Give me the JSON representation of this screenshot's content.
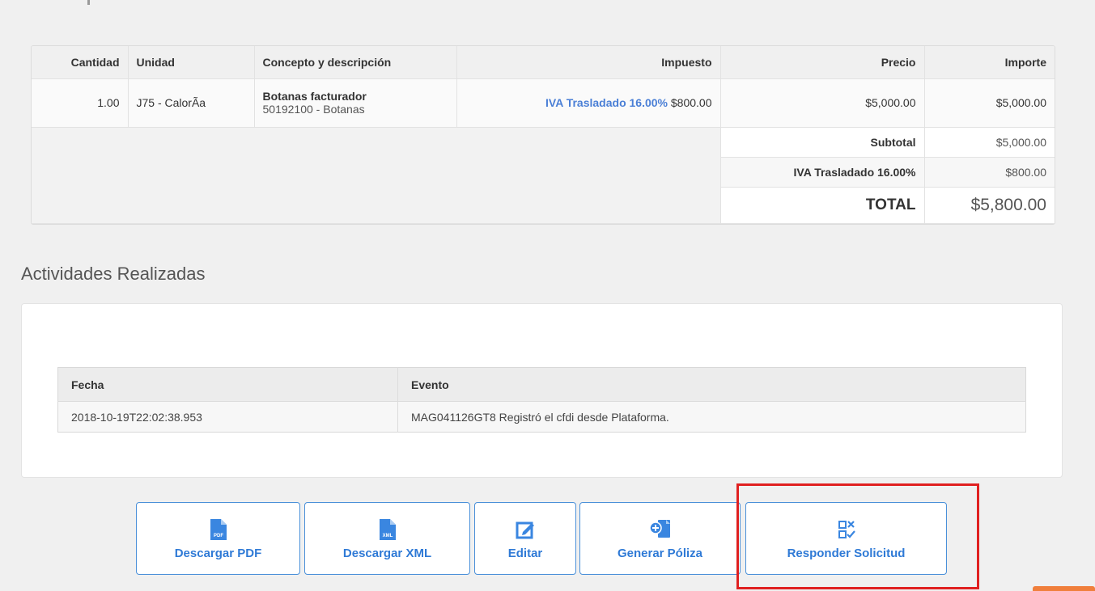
{
  "items_table": {
    "headers": [
      "Cantidad",
      "Unidad",
      "Concepto y descripción",
      "Impuesto",
      "Precio",
      "Importe"
    ],
    "rows": [
      {
        "cantidad": "1.00",
        "unidad": "J75 - CalorÃa",
        "concepto": "Botanas facturador",
        "descripcion": "50192100 - Botanas",
        "impuesto_link": "IVA Trasladado 16.00%",
        "impuesto_amount": "$800.00",
        "precio": "$5,000.00",
        "importe": "$5,000.00"
      }
    ],
    "summary": {
      "subtotal_label": "Subtotal",
      "subtotal_value": "$5,000.00",
      "tax_label": "IVA Trasladado 16.00%",
      "tax_value": "$800.00",
      "total_label": "TOTAL",
      "total_value": "$5,800.00"
    }
  },
  "activities": {
    "title": "Actividades Realizadas",
    "headers": [
      "Fecha",
      "Evento"
    ],
    "rows": [
      {
        "fecha": "2018-10-19T22:02:38.953",
        "evento": "MAG041126GT8 Registró el cfdi desde Plataforma."
      }
    ]
  },
  "actions": {
    "pdf": {
      "label": "Descargar PDF",
      "icon": "pdf-file-icon",
      "badge": "PDF"
    },
    "xml": {
      "label": "Descargar XML",
      "icon": "xml-file-icon",
      "badge": "XML"
    },
    "edit": {
      "label": "Editar",
      "icon": "edit-icon"
    },
    "poliza": {
      "label": "Generar Póliza",
      "icon": "generate-document-icon"
    },
    "respond": {
      "label": "Responder Solicitud",
      "icon": "respond-check-icon"
    }
  },
  "colors": {
    "accent": "#2f7ad6",
    "highlight": "#e02020",
    "tax_link": "#4a7fd6"
  }
}
